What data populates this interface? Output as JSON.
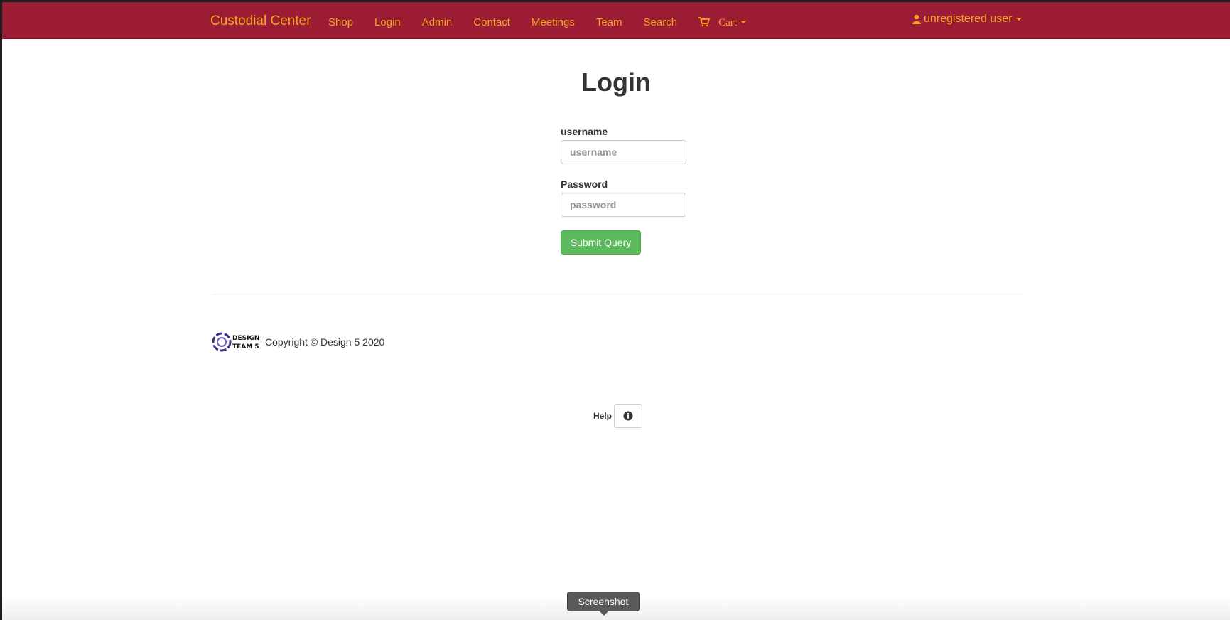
{
  "navbar": {
    "brand": "Custodial Center",
    "links": [
      "Shop",
      "Login",
      "Admin",
      "Contact",
      "Meetings",
      "Team",
      "Search"
    ],
    "cart_label": "Cart",
    "user_label": "unregistered user"
  },
  "main": {
    "title": "Login",
    "username_label": "username",
    "username_placeholder": "username",
    "password_label": "Password",
    "password_placeholder": "password",
    "submit_label": "Submit Query"
  },
  "footer": {
    "logo_text_line1": "DESIGN",
    "logo_text_line2": "TEAM 5",
    "copyright": "Copyright © Design 5 2020"
  },
  "help": {
    "label": "Help"
  },
  "tooltip": {
    "label": "Screenshot"
  },
  "colors": {
    "navbar_bg": "#9b1c33",
    "nav_text": "#f5a623",
    "submit_bg": "#5cb85c"
  },
  "icons": {
    "cart": "shopping-cart-icon",
    "user": "user-icon",
    "help": "info-circle-icon"
  }
}
